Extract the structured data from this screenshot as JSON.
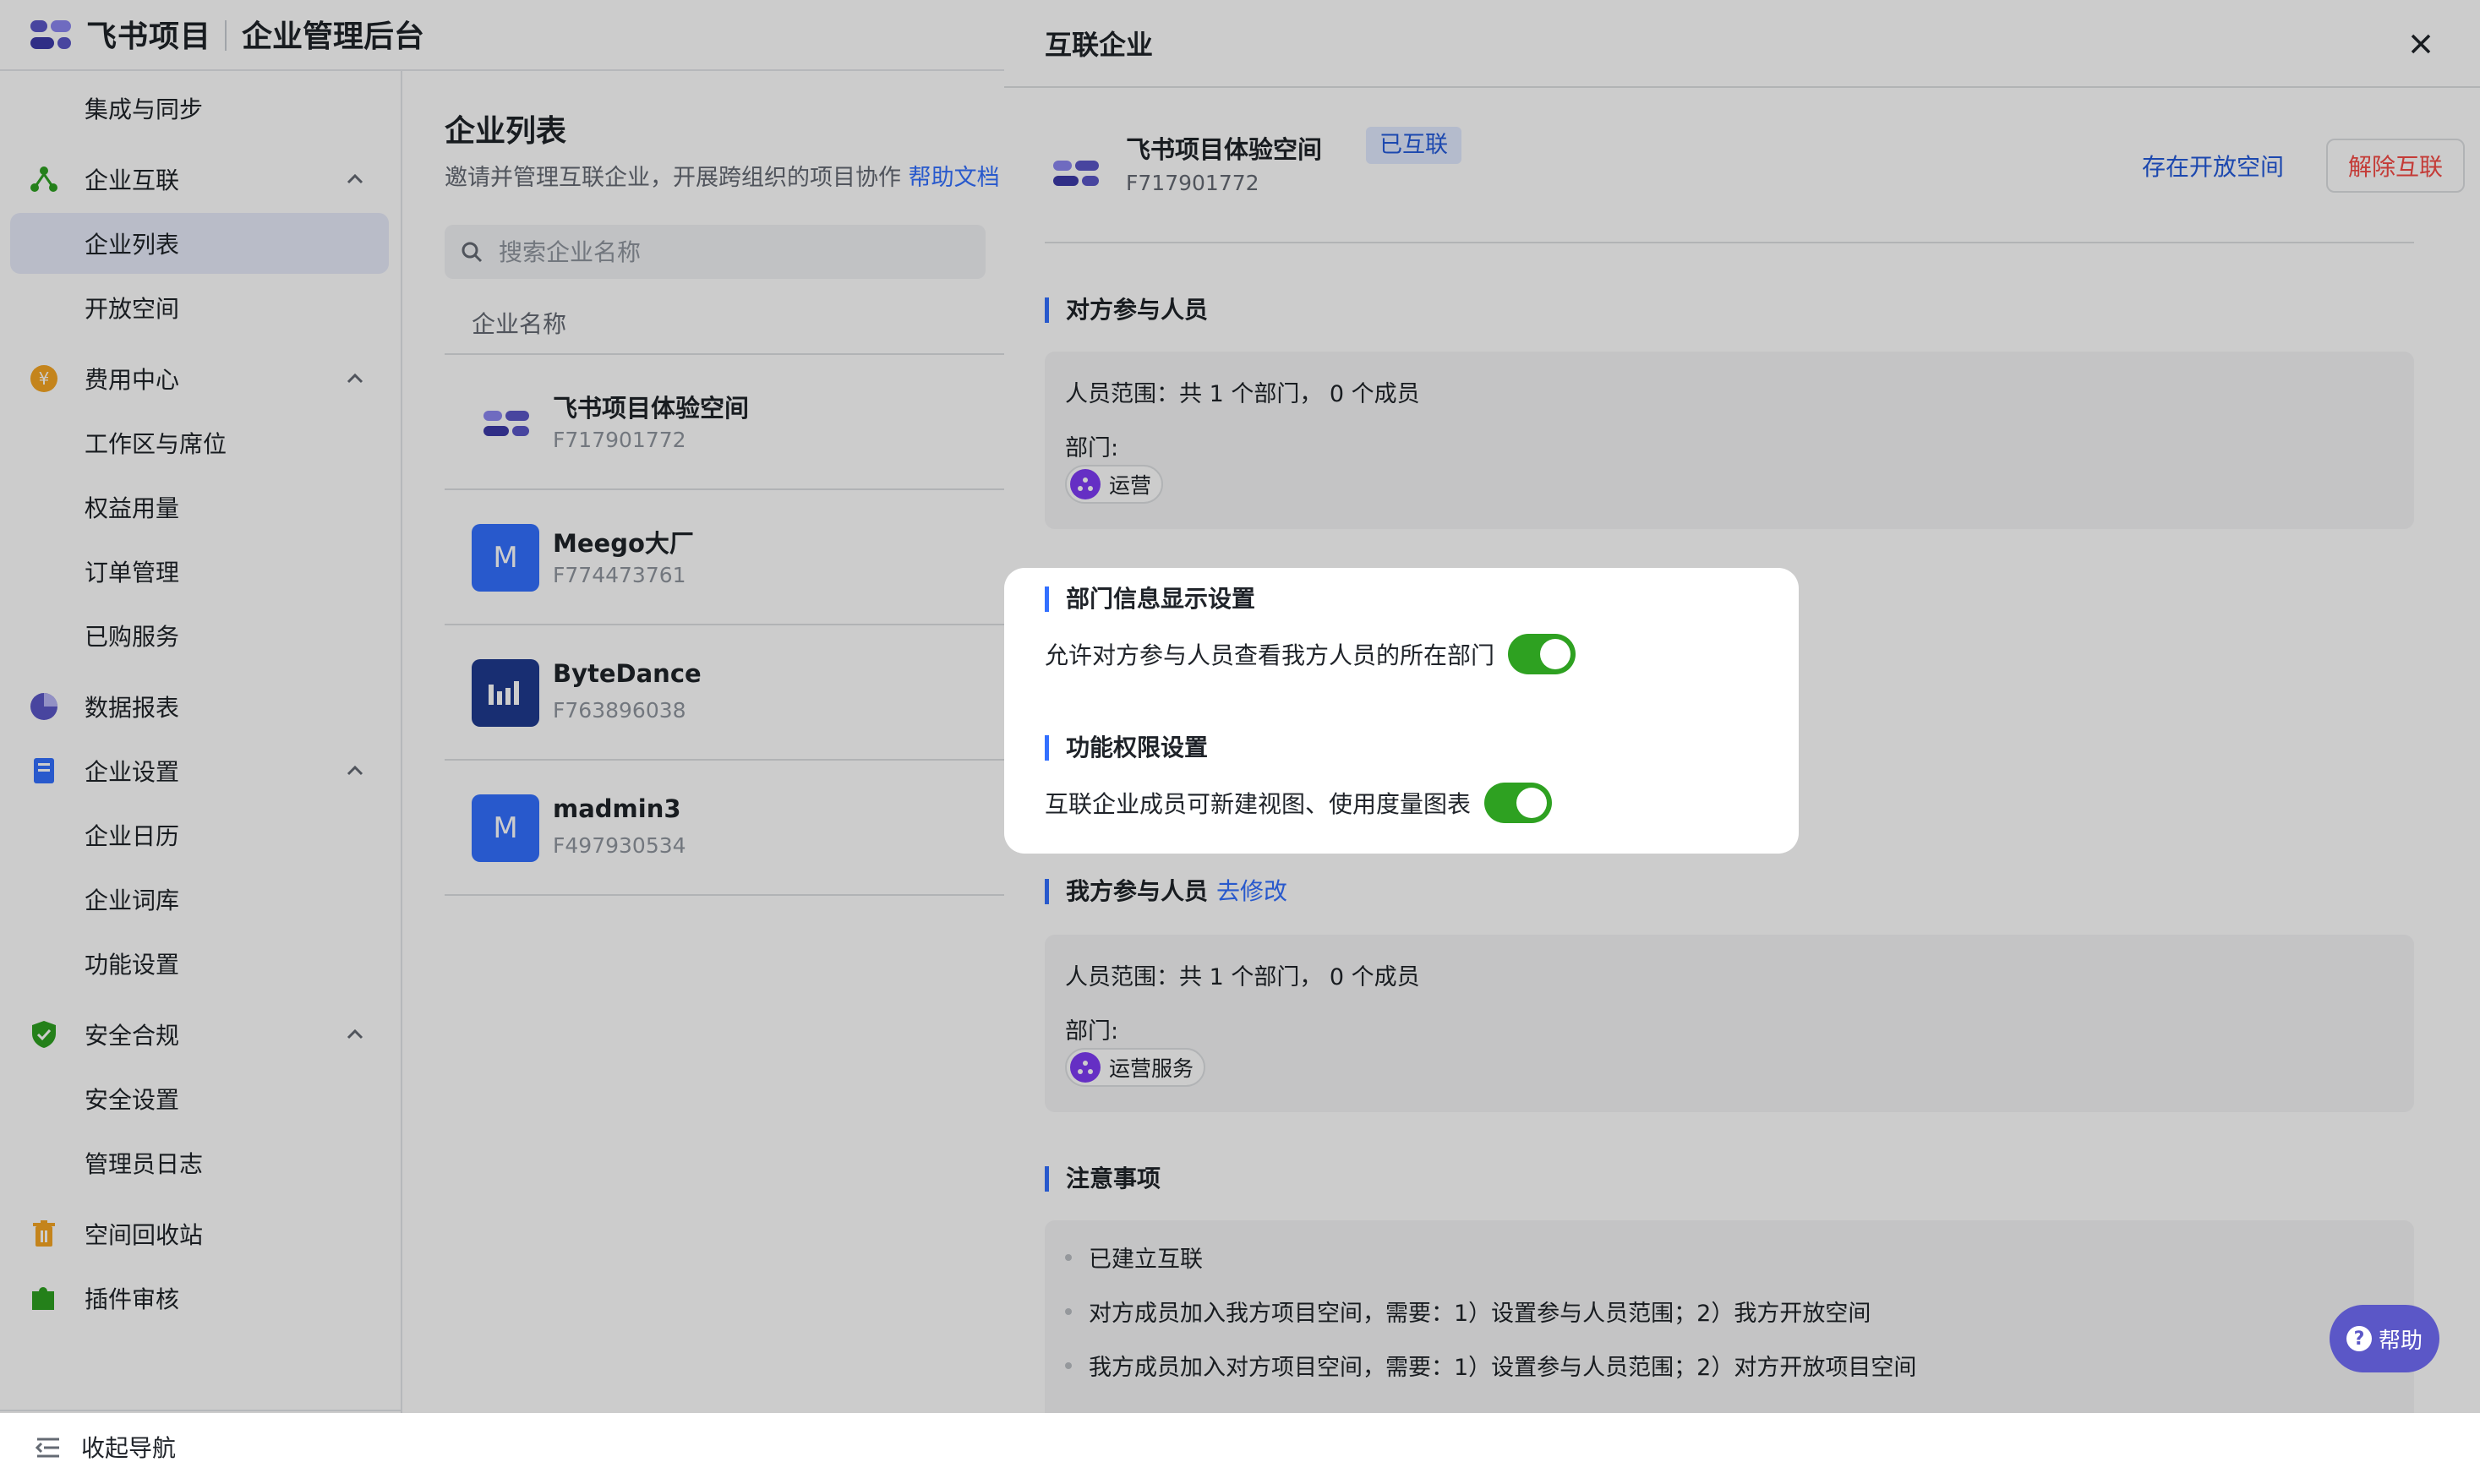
{
  "topbar": {
    "brand": "飞书项目",
    "console": "企业管理后台"
  },
  "sidebar": {
    "items": [
      {
        "label": "集成与同步"
      },
      {
        "label": "企业互联"
      },
      {
        "label": "企业列表"
      },
      {
        "label": "开放空间"
      },
      {
        "label": "费用中心"
      },
      {
        "label": "工作区与席位"
      },
      {
        "label": "权益用量"
      },
      {
        "label": "订单管理"
      },
      {
        "label": "已购服务"
      },
      {
        "label": "数据报表"
      },
      {
        "label": "企业设置"
      },
      {
        "label": "企业日历"
      },
      {
        "label": "企业词库"
      },
      {
        "label": "功能设置"
      },
      {
        "label": "安全合规"
      },
      {
        "label": "安全设置"
      },
      {
        "label": "管理员日志"
      },
      {
        "label": "空间回收站"
      },
      {
        "label": "插件审核"
      }
    ],
    "collapse_label": "收起导航"
  },
  "main": {
    "title": "企业列表",
    "desc": "邀请并管理互联企业，开展跨组织的项目协作",
    "help_link": "帮助文档",
    "search_placeholder": "搜索企业名称",
    "column_header": "企业名称",
    "rows": [
      {
        "name": "飞书项目体验空间",
        "id": "F717901772",
        "avatar": ""
      },
      {
        "name": "Meego大厂",
        "id": "F774473761",
        "avatar": "M"
      },
      {
        "name": "ByteDance",
        "id": "F763896038",
        "avatar": ""
      },
      {
        "name": "madmin3",
        "id": "F497930534",
        "avatar": "M"
      }
    ]
  },
  "drawer": {
    "title": "互联企业",
    "enterprise": {
      "name": "飞书项目体验空间",
      "badge": "已互联",
      "id": "F717901772"
    },
    "open_space_link": "存在开放空间",
    "unlink_button": "解除互联",
    "their_members": {
      "title": "对方参与人员",
      "range": "人员范围：共 1 个部门， 0 个成员",
      "dept_label": "部门:",
      "dept": "运营"
    },
    "dept_display": {
      "title": "部门信息显示设置",
      "setting": "允许对方参与人员查看我方人员的所在部门",
      "enabled": true
    },
    "permissions": {
      "title": "功能权限设置",
      "setting": "互联企业成员可新建视图、使用度量图表",
      "enabled": true
    },
    "our_members": {
      "title": "我方参与人员",
      "edit": "去修改",
      "range": "人员范围：共 1 个部门， 0 个成员",
      "dept_label": "部门:",
      "dept": "运营服务"
    },
    "notes": {
      "title": "注意事项",
      "items": [
        "已建立互联",
        "对方成员加入我方项目空间，需要：1）设置参与人员范围；2）我方开放空间",
        "我方成员加入对方项目空间，需要：1）设置参与人员范围；2）对方开放项目空间"
      ]
    }
  },
  "help": {
    "label": "帮助"
  },
  "colors": {
    "accent": "#3370ff",
    "toggle_on": "#2ea121",
    "danger": "#f54a45",
    "help": "#5b57c7"
  }
}
